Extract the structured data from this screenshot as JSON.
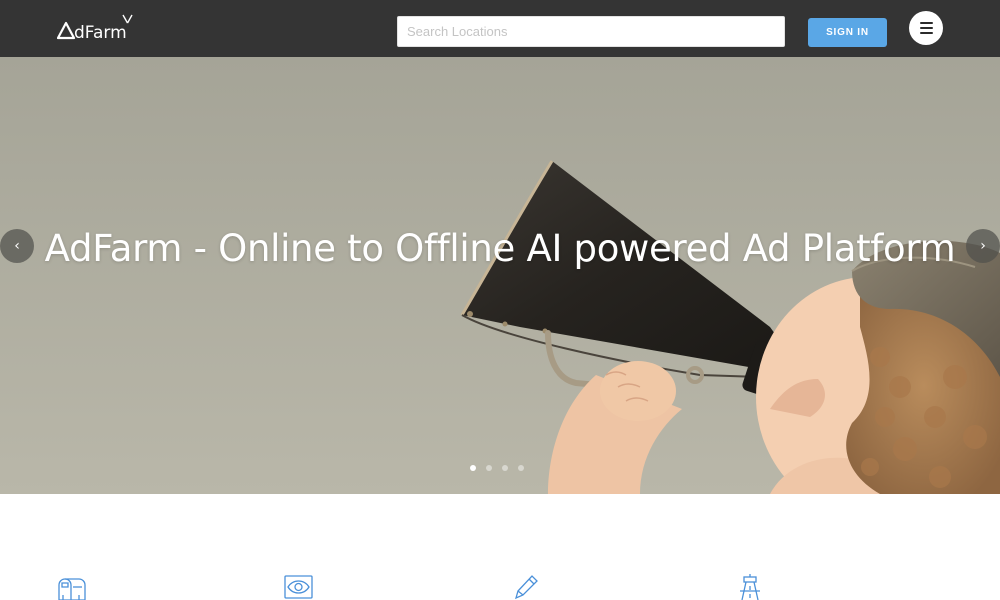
{
  "header": {
    "logo_text": "AdFarm",
    "search": {
      "placeholder": "Search Locations",
      "value": ""
    },
    "signin_label": "SIGN IN",
    "menu_icon": "hamburger-icon"
  },
  "hero": {
    "title": "AdFarm - Online to Offline AI powered Ad Platform",
    "prev_label": "‹",
    "next_label": "›",
    "slides_count": 4,
    "active_slide": 1
  },
  "features": {
    "icons": [
      "mailbox-icon",
      "eye-icon",
      "pencil-icon",
      "billboard-icon"
    ]
  },
  "colors": {
    "header_bg": "#343434",
    "accent": "#5aa7e6",
    "icon_blue": "#4a90d9"
  }
}
